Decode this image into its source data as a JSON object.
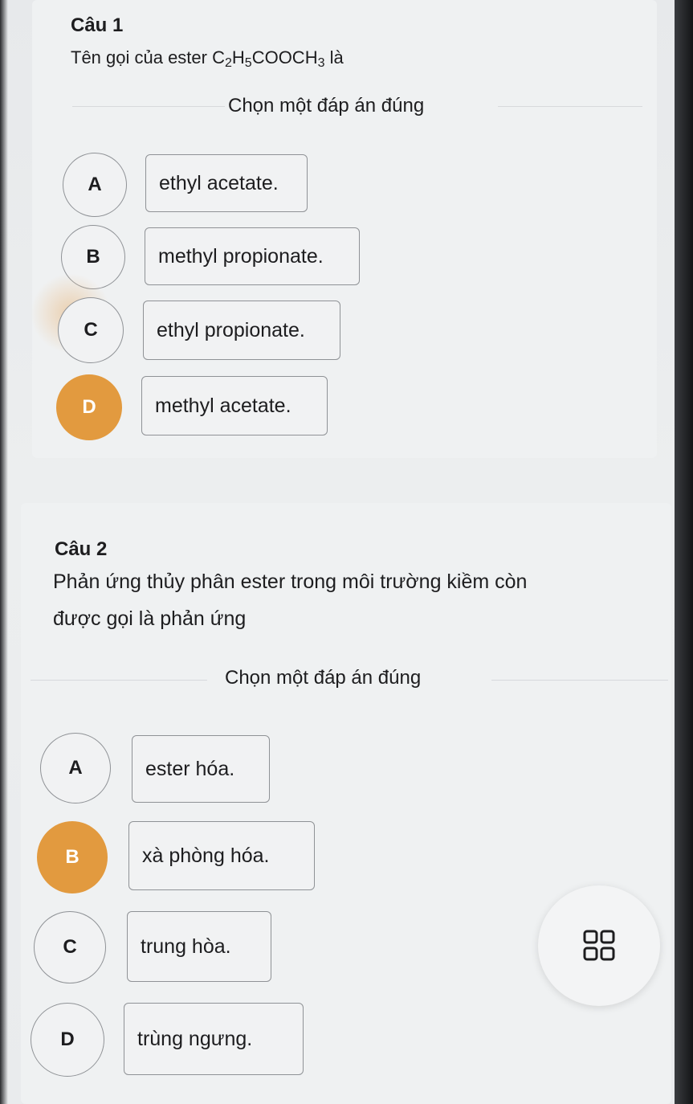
{
  "questions": [
    {
      "title": "Câu 1",
      "text_before": "Tên gọi của ester C",
      "formula_sub1": "2",
      "formula_mid1": "H",
      "formula_sub2": "5",
      "formula_mid2": "COOCH",
      "formula_sub3": "3",
      "text_after": " là",
      "prompt": "Chọn một đáp án đúng",
      "selected": "D",
      "options": [
        {
          "letter": "A",
          "text": "ethyl acetate."
        },
        {
          "letter": "B",
          "text": "methyl propionate."
        },
        {
          "letter": "C",
          "text": "ethyl propionate."
        },
        {
          "letter": "D",
          "text": "methyl acetate."
        }
      ]
    },
    {
      "title": "Câu 2",
      "text_line1": "Phản ứng thủy phân ester trong môi trường kiềm còn",
      "text_line2": "được gọi là phản ứng",
      "prompt": "Chọn một đáp án đúng",
      "selected": "B",
      "options": [
        {
          "letter": "A",
          "text": "ester hóa."
        },
        {
          "letter": "B",
          "text": "xà phòng hóa."
        },
        {
          "letter": "C",
          "text": "trung hòa."
        },
        {
          "letter": "D",
          "text": "trùng ngưng."
        }
      ]
    }
  ],
  "fab_icon": "grid-icon",
  "colors": {
    "selected": "#e29a3f",
    "border": "#8f9296",
    "background": "#eceeef"
  }
}
